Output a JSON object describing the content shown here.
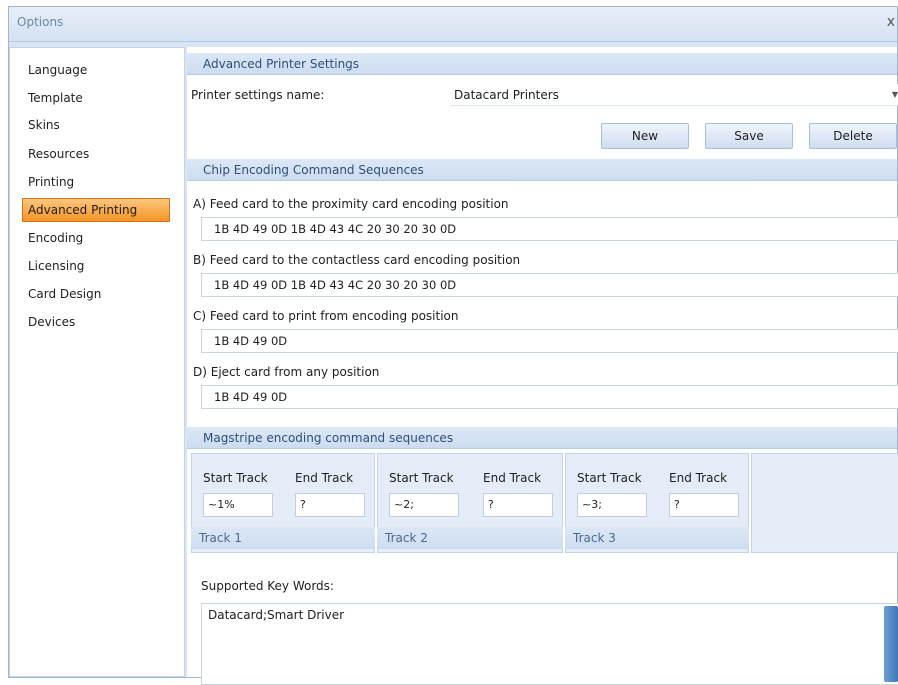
{
  "window": {
    "title": "Options",
    "close": "x"
  },
  "sidebar": {
    "items": [
      {
        "label": "Language"
      },
      {
        "label": "Template"
      },
      {
        "label": "Skins"
      },
      {
        "label": "Resources"
      },
      {
        "label": "Printing"
      },
      {
        "label": "Advanced Printing",
        "selected": true
      },
      {
        "label": "Encoding"
      },
      {
        "label": "Licensing"
      },
      {
        "label": "Card Design"
      },
      {
        "label": "Devices"
      }
    ]
  },
  "advanced_printer": {
    "header": "Advanced Printer Settings",
    "name_label": "Printer settings name:",
    "name_value": "Datacard Printers",
    "buttons": {
      "new": "New",
      "save": "Save",
      "delete": "Delete"
    }
  },
  "chip_encoding": {
    "header": "Chip Encoding Command Sequences",
    "items": [
      {
        "label": "A) Feed card to the proximity card encoding position",
        "value": "1B 4D 49 0D 1B 4D 43 4C 20 30 20 30 0D"
      },
      {
        "label": "B) Feed card to the contactless card encoding position",
        "value": "1B 4D 49 0D 1B 4D 43 4C 20 30 20 30 0D"
      },
      {
        "label": "C) Feed card to print from encoding position",
        "value": "1B 4D 49 0D"
      },
      {
        "label": "D) Eject card from any position",
        "value": "1B 4D 49 0D"
      }
    ]
  },
  "magstripe": {
    "header": "Magstripe encoding command sequences",
    "start_label": "Start Track",
    "end_label": "End Track",
    "tracks": [
      {
        "name": "Track 1",
        "start": "~1%",
        "end": "?"
      },
      {
        "name": "Track 2",
        "start": "~2;",
        "end": "?"
      },
      {
        "name": "Track 3",
        "start": "~3;",
        "end": "?"
      }
    ]
  },
  "keywords": {
    "label": "Supported Key Words:",
    "value": "Datacard;Smart Driver"
  }
}
